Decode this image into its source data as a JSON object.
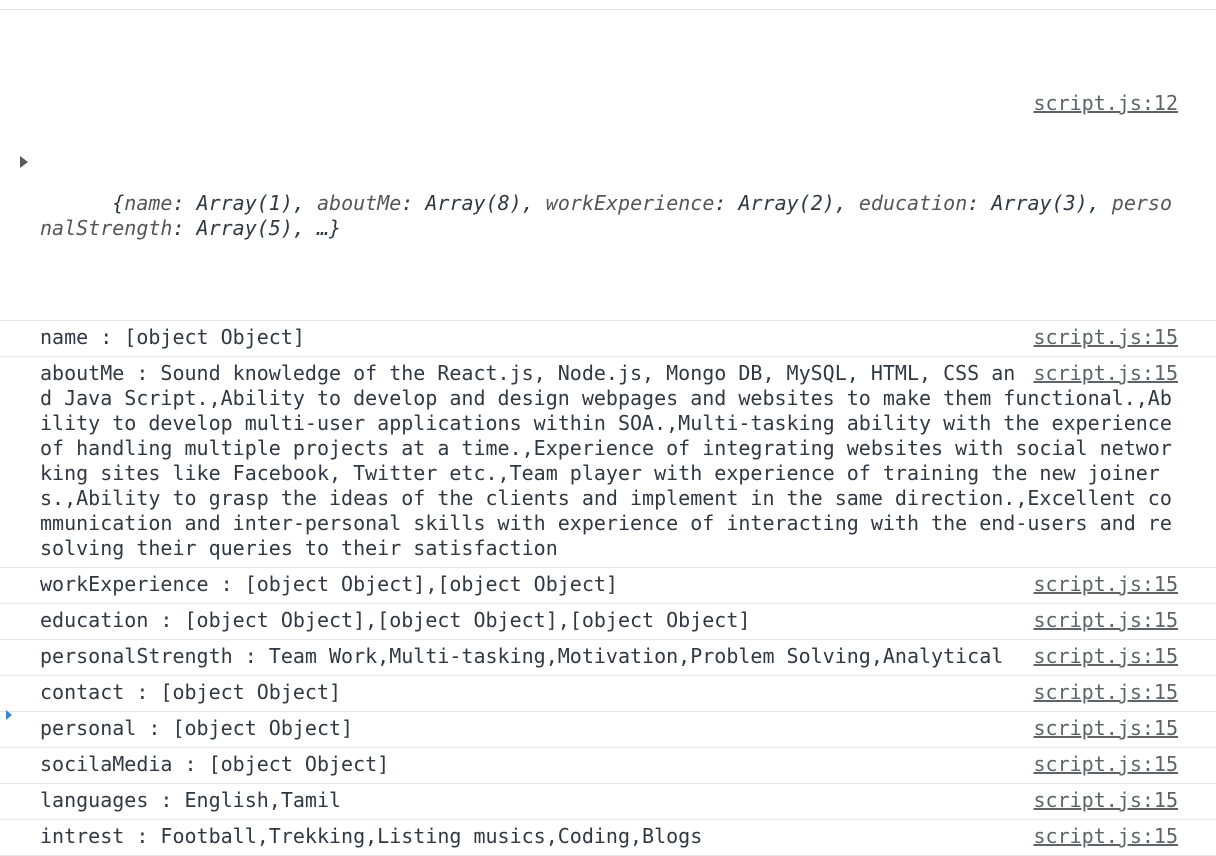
{
  "object_message": {
    "source": "script.js:12",
    "summary": "{name: Array(1), aboutMe: Array(8), workExperience: Array(2), education: Array(3), perso nalStrength: Array(5), …}",
    "parts": [
      {
        "key": "name",
        "value": "Array(1)"
      },
      {
        "key": "aboutMe",
        "value": "Array(8)"
      },
      {
        "key": "workExperience",
        "value": "Array(2)"
      },
      {
        "key": "education",
        "value": "Array(3)"
      },
      {
        "key": "perso\nnalStrength",
        "value": "Array(5)"
      }
    ],
    "tail": ", …}"
  },
  "messages": [
    {
      "text": "name : [object Object]",
      "source": "script.js:15"
    },
    {
      "text": "aboutMe : Sound knowledge of the React.js, Node.js, Mongo DB, MySQL, HTML, CSS and Java Script.,Ability to develop and design webpages and websites to make them functional.,Ability to develop multi-user applications within SOA.,Multi-tasking ability with the experience of handling multiple projects at a time.,Experience of integrating websites with social networking sites like Facebook, Twitter etc.,Team player with experience of training the new joiners.,Ability to grasp the ideas of the clients and implement in the same direction.,Excellent communication and inter-personal skills with experience of interacting with the end-users and resolving their queries to their satisfaction",
      "source": "script.js:15"
    },
    {
      "text": "workExperience : [object Object],[object Object]",
      "source": "script.js:15"
    },
    {
      "text": "education : [object Object],[object Object],[object Object]",
      "source": "script.js:15"
    },
    {
      "text": "personalStrength : Team Work,Multi-tasking,Motivation,Problem Solving,Analytical",
      "source": "script.js:15"
    },
    {
      "text": "contact : [object Object]",
      "source": "script.js:15"
    },
    {
      "text": "personal : [object Object]",
      "source": "script.js:15"
    },
    {
      "text": "socilaMedia : [object Object]",
      "source": "script.js:15"
    },
    {
      "text": "languages : English,Tamil",
      "source": "script.js:15"
    },
    {
      "text": "intrest : Football,Trekking,Listing musics,Coding,Blogs",
      "source": "script.js:15"
    }
  ],
  "icons": {
    "expander": "triangle-right-icon",
    "prompt": "prompt-caret-icon"
  }
}
